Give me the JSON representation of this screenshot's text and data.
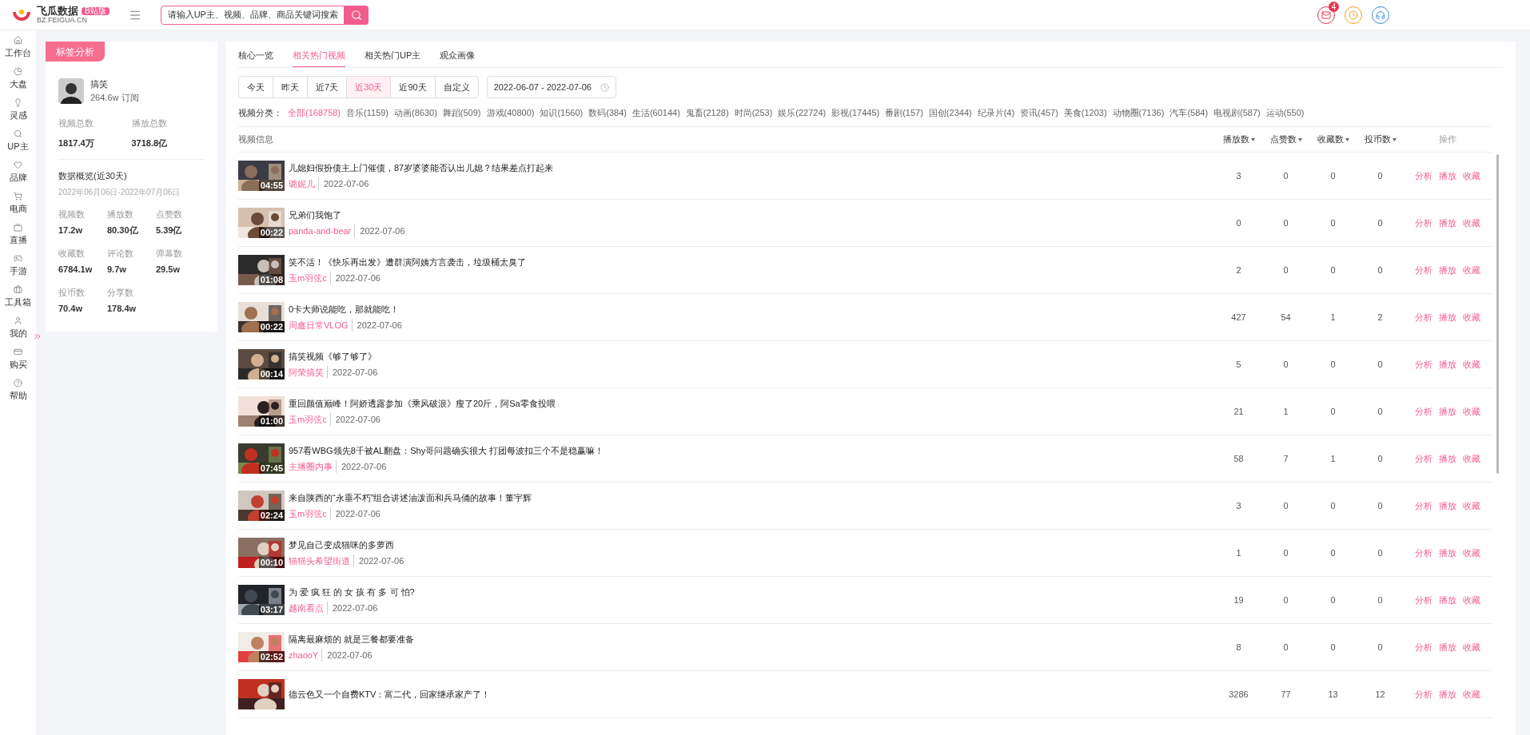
{
  "header": {
    "logo": {
      "name": "飞瓜数据",
      "badge": "B站版",
      "domain": "BZ.FEIGUA.CN"
    },
    "search": {
      "placeholder": "请输入UP主、视频、品牌、商品关键词搜索"
    },
    "notifications": {
      "count": "4"
    }
  },
  "sidebar": {
    "items": [
      {
        "label": "工作台"
      },
      {
        "label": "大盘"
      },
      {
        "label": "灵感"
      },
      {
        "label": "UP主"
      },
      {
        "label": "品牌"
      },
      {
        "label": "电商"
      },
      {
        "label": "直播"
      },
      {
        "label": "手游"
      },
      {
        "label": "工具箱"
      },
      {
        "label": "我的"
      },
      {
        "label": "购买"
      },
      {
        "label": "帮助"
      }
    ]
  },
  "profile": {
    "tag": "标签分析",
    "name": "搞笑",
    "subscribers": "264.6w 订阅",
    "totals": [
      {
        "label": "视频总数",
        "value": "1817.4万"
      },
      {
        "label": "播放总数",
        "value": "3718.8亿"
      }
    ],
    "overview_title": "数据概览(近30天)",
    "overview_range": "2022年06月06日-2022年07月06日",
    "stats": [
      {
        "label": "视频数",
        "value": "17.2w"
      },
      {
        "label": "播放数",
        "value": "80.30亿"
      },
      {
        "label": "点赞数",
        "value": "5.39亿"
      },
      {
        "label": "收藏数",
        "value": "6784.1w"
      },
      {
        "label": "评论数",
        "value": "9.7w"
      },
      {
        "label": "弹幕数",
        "value": "29.5w"
      },
      {
        "label": "投币数",
        "value": "70.4w"
      },
      {
        "label": "分享数",
        "value": "178.4w"
      }
    ]
  },
  "tabs": [
    {
      "label": "核心一览",
      "selected": false
    },
    {
      "label": "相关热门视频",
      "selected": true
    },
    {
      "label": "相关热门UP主",
      "selected": false
    },
    {
      "label": "观众画像",
      "selected": false
    }
  ],
  "ranges": [
    {
      "label": "今天",
      "selected": false
    },
    {
      "label": "昨天",
      "selected": false
    },
    {
      "label": "近7天",
      "selected": false
    },
    {
      "label": "近30天",
      "selected": true
    },
    {
      "label": "近90天",
      "selected": false
    },
    {
      "label": "自定义",
      "selected": false
    }
  ],
  "date_range": "2022-06-07 - 2022-07-06",
  "categories_label": "视频分类：",
  "categories": [
    {
      "label": "全部(168758)",
      "selected": true
    },
    {
      "label": "音乐(1159)",
      "selected": false
    },
    {
      "label": "动画(8630)",
      "selected": false
    },
    {
      "label": "舞蹈(509)",
      "selected": false
    },
    {
      "label": "游戏(40800)",
      "selected": false
    },
    {
      "label": "知识(1560)",
      "selected": false
    },
    {
      "label": "数码(384)",
      "selected": false
    },
    {
      "label": "生活(60144)",
      "selected": false
    },
    {
      "label": "鬼畜(2128)",
      "selected": false
    },
    {
      "label": "时尚(253)",
      "selected": false
    },
    {
      "label": "娱乐(22724)",
      "selected": false
    },
    {
      "label": "影视(17445)",
      "selected": false
    },
    {
      "label": "番剧(157)",
      "selected": false
    },
    {
      "label": "国创(2344)",
      "selected": false
    },
    {
      "label": "纪录片(4)",
      "selected": false
    },
    {
      "label": "资讯(457)",
      "selected": false
    },
    {
      "label": "美食(1203)",
      "selected": false
    },
    {
      "label": "动物圈(7136)",
      "selected": false
    },
    {
      "label": "汽车(584)",
      "selected": false
    },
    {
      "label": "电视剧(587)",
      "selected": false
    },
    {
      "label": "运动(550)",
      "selected": false
    }
  ],
  "table": {
    "columns": [
      "视频信息",
      "播放数",
      "点赞数",
      "收藏数",
      "投币数",
      "操作"
    ],
    "rows": [
      {
        "title": "儿媳妇假扮债主上门催债，87岁婆婆能否认出儿媳？结果差点打起来",
        "author": "璐妮儿",
        "date": "2022-07-06",
        "duration": "04:55",
        "plays": "3",
        "likes": "0",
        "favorites": "0",
        "coins": "0",
        "actions": [
          "分析",
          "播放",
          "收藏"
        ]
      },
      {
        "title": "兄弟们我饱了",
        "author": "panda-and-bear",
        "date": "2022-07-06",
        "duration": "00:22",
        "plays": "0",
        "likes": "0",
        "favorites": "0",
        "coins": "0",
        "actions": [
          "分析",
          "播放",
          "收藏"
        ]
      },
      {
        "title": "笑不活！《快乐再出发》遭群演阿姨方言袭击，垃圾桶太臭了",
        "author": "玉m羽弦c",
        "date": "2022-07-06",
        "duration": "01:08",
        "plays": "2",
        "likes": "0",
        "favorites": "0",
        "coins": "0",
        "actions": [
          "分析",
          "播放",
          "收藏"
        ]
      },
      {
        "title": "0卡大师说能吃，那就能吃！",
        "author": "周鑫日常VLOG",
        "date": "2022-07-06",
        "duration": "00:22",
        "plays": "427",
        "likes": "54",
        "favorites": "1",
        "coins": "2",
        "actions": [
          "分析",
          "播放",
          "收藏"
        ]
      },
      {
        "title": "搞笑视频《够了够了》",
        "author": "阿荣搞笑",
        "date": "2022-07-06",
        "duration": "00:14",
        "plays": "5",
        "likes": "0",
        "favorites": "0",
        "coins": "0",
        "actions": [
          "分析",
          "播放",
          "收藏"
        ]
      },
      {
        "title": "重回颜值巅峰！阿娇透露参加《乘风破浪》瘦了20斤，阿Sa零食投喂",
        "author": "玉m羽弦c",
        "date": "2022-07-06",
        "duration": "01:00",
        "plays": "21",
        "likes": "1",
        "favorites": "0",
        "coins": "0",
        "actions": [
          "分析",
          "播放",
          "收藏"
        ]
      },
      {
        "title": "957看WBG领先8千被AL翻盘：Shy哥问题确实很大 打团每波扣三个不是稳赢嘛！",
        "author": "主播圈内事",
        "date": "2022-07-06",
        "duration": "07:45",
        "plays": "58",
        "likes": "7",
        "favorites": "1",
        "coins": "0",
        "actions": [
          "分析",
          "播放",
          "收藏"
        ]
      },
      {
        "title": "来自陕西的“永垂不朽”组合讲述油泼面和兵马俑的故事！董宇辉",
        "author": "玉m羽弦c",
        "date": "2022-07-06",
        "duration": "02:24",
        "plays": "3",
        "likes": "0",
        "favorites": "0",
        "coins": "0",
        "actions": [
          "分析",
          "播放",
          "收藏"
        ]
      },
      {
        "title": "梦见自己变成猫咪的多萝西",
        "author": "猫猫头希望街道",
        "date": "2022-07-06",
        "duration": "00:10",
        "plays": "1",
        "likes": "0",
        "favorites": "0",
        "coins": "0",
        "actions": [
          "分析",
          "播放",
          "收藏"
        ]
      },
      {
        "title": "为 爱 疯 狂 的 女 孩 有 多 可 怕?",
        "author": "越南看点",
        "date": "2022-07-06",
        "duration": "03:17",
        "plays": "19",
        "likes": "0",
        "favorites": "0",
        "coins": "0",
        "actions": [
          "分析",
          "播放",
          "收藏"
        ]
      },
      {
        "title": "隔离最麻烦的 就是三餐都要准备",
        "author": "zhaooY",
        "date": "2022-07-06",
        "duration": "02:52",
        "plays": "8",
        "likes": "0",
        "favorites": "0",
        "coins": "0",
        "actions": [
          "分析",
          "播放",
          "收藏"
        ]
      },
      {
        "title": "德云色又一个自费KTV：富二代，回家继承家产了！",
        "plays": "3286",
        "likes": "77",
        "favorites": "13",
        "coins": "12",
        "actions": [
          "分析",
          "播放",
          "收藏"
        ]
      }
    ]
  }
}
